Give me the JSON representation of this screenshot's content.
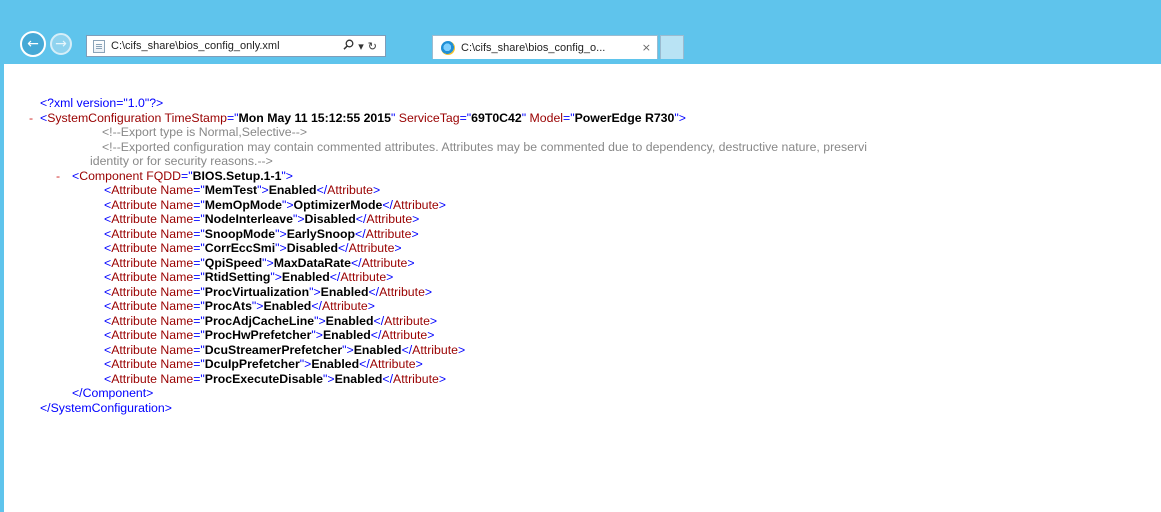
{
  "browser": {
    "address": "C:\\cifs_share\\bios_config_only.xml",
    "search_icon": "search-icon",
    "dropdown_glyph": "▾",
    "refresh_glyph": "↻",
    "tab_title": "C:\\cifs_share\\bios_config_o...",
    "tab_close": "×"
  },
  "xml": {
    "declaration": "<?xml version=\"1.0\"?>",
    "root": {
      "tag": "SystemConfiguration",
      "attrs": [
        {
          "name": "TimeStamp",
          "value": "Mon May 11 15:12:55 2015"
        },
        {
          "name": "ServiceTag",
          "value": "69T0C42"
        },
        {
          "name": "Model",
          "value": "PowerEdge R730"
        }
      ],
      "close": "</SystemConfiguration>"
    },
    "comments": [
      "<!--Export type is Normal,Selective-->",
      "<!--Exported configuration may contain commented attributes. Attributes may be commented due to dependency, destructive nature, preservi",
      "identity or for security reasons.-->"
    ],
    "component": {
      "tag": "Component",
      "attr_name": "FQDD",
      "attr_value": "BIOS.Setup.1-1",
      "close": "</Component>"
    },
    "attributes": [
      {
        "name": "MemTest",
        "value": "Enabled"
      },
      {
        "name": "MemOpMode",
        "value": "OptimizerMode"
      },
      {
        "name": "NodeInterleave",
        "value": "Disabled"
      },
      {
        "name": "SnoopMode",
        "value": "EarlySnoop"
      },
      {
        "name": "CorrEccSmi",
        "value": "Disabled"
      },
      {
        "name": "QpiSpeed",
        "value": "MaxDataRate"
      },
      {
        "name": "RtidSetting",
        "value": "Enabled"
      },
      {
        "name": "ProcVirtualization",
        "value": "Enabled"
      },
      {
        "name": "ProcAts",
        "value": "Enabled"
      },
      {
        "name": "ProcAdjCacheLine",
        "value": "Enabled"
      },
      {
        "name": "ProcHwPrefetcher",
        "value": "Enabled"
      },
      {
        "name": "DcuStreamerPrefetcher",
        "value": "Enabled"
      },
      {
        "name": "DcuIpPrefetcher",
        "value": "Enabled"
      },
      {
        "name": "ProcExecuteDisable",
        "value": "Enabled"
      }
    ],
    "collapse_glyph": "-"
  }
}
